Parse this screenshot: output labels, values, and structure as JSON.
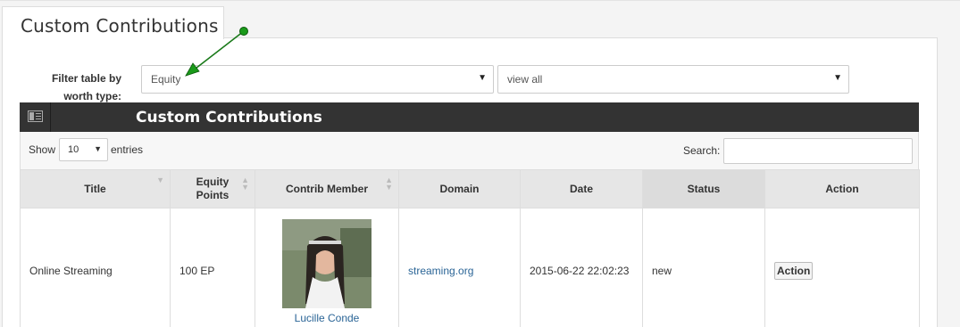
{
  "tab": {
    "title": "Custom Contributions"
  },
  "filter": {
    "label": "Filter table by worth type:",
    "worth_type": "Equity",
    "view": "view all"
  },
  "table": {
    "title": "Custom Contributions",
    "show_label": "Show",
    "entries_value": "10",
    "entries_label": "entries",
    "search_label": "Search:",
    "search_value": "",
    "columns": [
      "Title",
      "Equity Points",
      "Contrib Member",
      "Domain",
      "Date",
      "Status",
      "Action"
    ],
    "rows": [
      {
        "title": "Online Streaming",
        "points": "100 EP",
        "member": "Lucille Conde",
        "domain": "streaming.org",
        "date": "2015-06-22 22:02:23",
        "status": "new",
        "action": "Action"
      }
    ]
  },
  "colors": {
    "header_bg": "#333333",
    "link": "#2a6496",
    "arrow": "#1a7a1a"
  },
  "icons": {
    "table_header": "list-icon",
    "annotation": "green-arrow-annotation"
  }
}
